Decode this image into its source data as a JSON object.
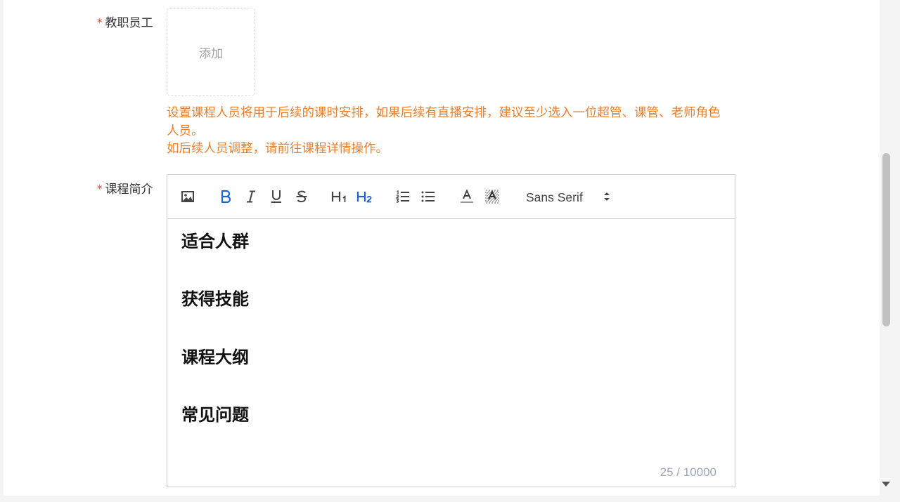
{
  "form": {
    "staff": {
      "required_mark": "*",
      "label": "教职员工",
      "add_label": "添加",
      "tip_lines": [
        "设置课程人员将用于后续的课时安排，如果后续有直播安排，建议至少选入一位超管、课管、老师角色",
        "人员。",
        "如后续人员调整，请前往课程详情操作。"
      ]
    },
    "intro": {
      "required_mark": "*",
      "label": "课程简介",
      "toolbar": {
        "font_family": "Sans Serif",
        "active_buttons": [
          "bold",
          "header-2"
        ]
      },
      "content_headings": [
        "适合人群",
        "获得技能",
        "课程大纲",
        "常见问题"
      ],
      "char_count": "25 / 10000"
    }
  },
  "colors": {
    "required": "#e8461e",
    "tip": "#e8802f",
    "active": "#1f63d2",
    "counter": "#9aa5b6"
  }
}
